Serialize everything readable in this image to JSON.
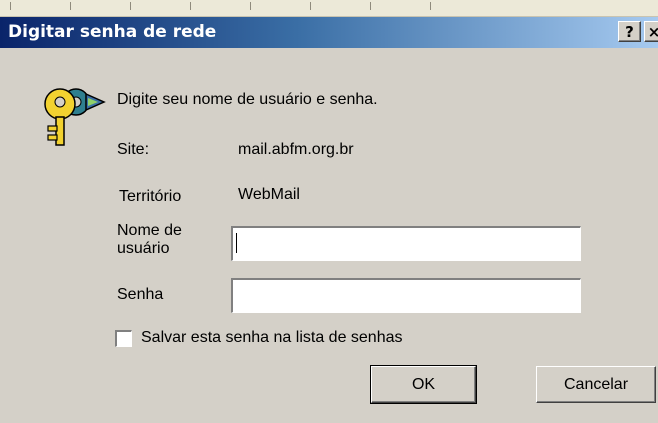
{
  "window": {
    "title": "Digitar senha de rede",
    "help_glyph": "?",
    "close_glyph": "×"
  },
  "dialog": {
    "prompt": "Digite seu nome de usuário e senha.",
    "site_label": "Site:",
    "site_value": "mail.abfm.org.br",
    "territory_label": "Território",
    "territory_value": "WebMail",
    "username_label": "Nome de usuário",
    "username_value": "",
    "password_label": "Senha",
    "password_value": "",
    "save_password_label": "Salvar esta senha na lista de senhas",
    "save_password_checked": false,
    "ok_label": "OK",
    "cancel_label": "Cancelar"
  },
  "icons": {
    "dialog_icon": "keys-icon",
    "help": "help-icon",
    "close": "close-icon"
  },
  "colors": {
    "title_bar_start": "#0a246a",
    "title_bar_end": "#a6caf0",
    "dialog_background": "#d4d0c8"
  }
}
